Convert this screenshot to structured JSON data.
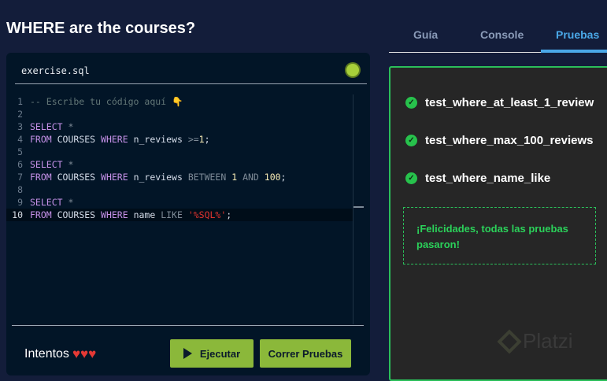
{
  "title": "WHERE are the courses?",
  "editor": {
    "filename": "exercise.sql",
    "status_color": "#a7cf3a"
  },
  "code": [
    {
      "n": "1",
      "parts": [
        {
          "c": "cm",
          "t": "-- Escribe tu código aquí 👇"
        }
      ]
    },
    {
      "n": "2",
      "parts": []
    },
    {
      "n": "3",
      "parts": [
        {
          "c": "kw",
          "t": "SELECT"
        },
        {
          "c": "op",
          "t": " *"
        }
      ]
    },
    {
      "n": "4",
      "parts": [
        {
          "c": "kw",
          "t": "FROM"
        },
        {
          "c": "id",
          "t": " COURSES "
        },
        {
          "c": "kw",
          "t": "WHERE"
        },
        {
          "c": "id",
          "t": " n_reviews "
        },
        {
          "c": "op",
          "t": ">="
        },
        {
          "c": "nm",
          "t": "1"
        },
        {
          "c": "id",
          "t": ";"
        }
      ]
    },
    {
      "n": "5",
      "parts": []
    },
    {
      "n": "6",
      "parts": [
        {
          "c": "kw",
          "t": "SELECT"
        },
        {
          "c": "op",
          "t": " *"
        }
      ]
    },
    {
      "n": "7",
      "parts": [
        {
          "c": "kw",
          "t": "FROM"
        },
        {
          "c": "id",
          "t": " COURSES "
        },
        {
          "c": "kw",
          "t": "WHERE"
        },
        {
          "c": "id",
          "t": " n_reviews "
        },
        {
          "c": "op",
          "t": "BETWEEN "
        },
        {
          "c": "nm",
          "t": "1"
        },
        {
          "c": "op",
          "t": " AND "
        },
        {
          "c": "nm",
          "t": "100"
        },
        {
          "c": "id",
          "t": ";"
        }
      ]
    },
    {
      "n": "8",
      "parts": []
    },
    {
      "n": "9",
      "parts": [
        {
          "c": "kw",
          "t": "SELECT"
        },
        {
          "c": "op",
          "t": " *"
        }
      ]
    },
    {
      "n": "10",
      "parts": [
        {
          "c": "kw",
          "t": "FROM"
        },
        {
          "c": "id",
          "t": " COURSES "
        },
        {
          "c": "kw",
          "t": "WHERE"
        },
        {
          "c": "id",
          "t": " name "
        },
        {
          "c": "op",
          "t": "LIKE "
        },
        {
          "c": "st",
          "t": "'%SQL%'"
        },
        {
          "c": "id",
          "t": ";"
        }
      ],
      "active": true
    }
  ],
  "footer": {
    "intentos": "Intentos",
    "hearts": 3,
    "run_label": "Ejecutar",
    "test_label": "Correr Pruebas"
  },
  "tabs": [
    {
      "label": "Guía"
    },
    {
      "label": "Console"
    },
    {
      "label": "Pruebas",
      "active": true
    }
  ],
  "tests": [
    "test_where_at_least_1_review",
    "test_where_max_100_reviews",
    "test_where_name_like"
  ],
  "success_message": "¡Felicidades, todas las pruebas pasaron!",
  "watermark": "Platzi"
}
